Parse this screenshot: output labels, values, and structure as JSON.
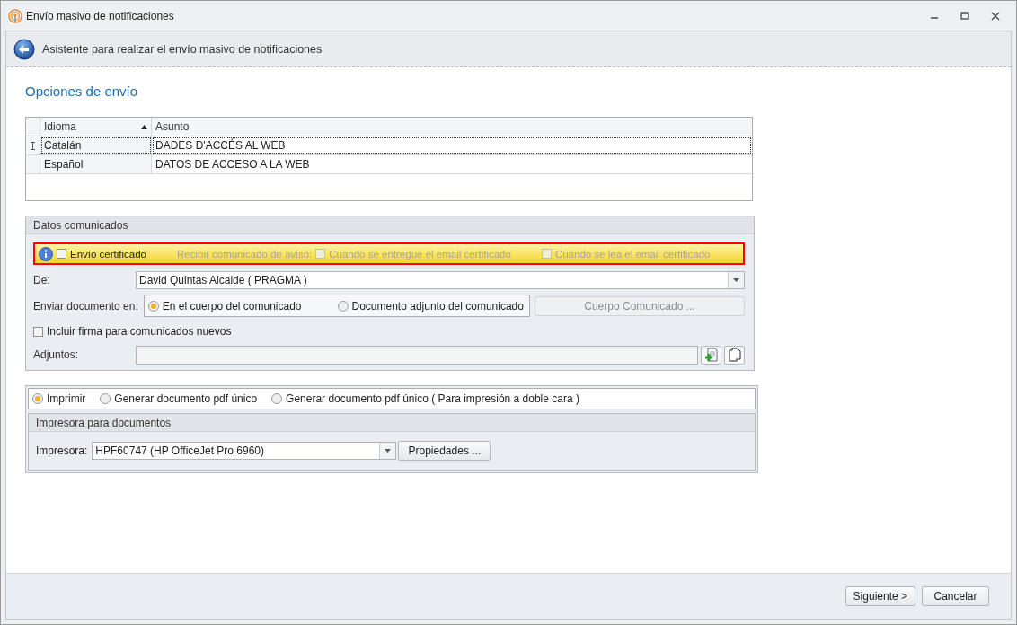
{
  "window": {
    "title": "Envío masivo de notificaciones"
  },
  "header": {
    "title": "Asistente para realizar el envío masivo de notificaciones"
  },
  "section_title": "Opciones de envío",
  "table": {
    "columns": [
      {
        "label": "Idioma",
        "sorted": true
      },
      {
        "label": "Asunto",
        "sorted": false
      }
    ],
    "rows": [
      {
        "cells": [
          "Catalán",
          "DADES D'ACCÉS AL WEB"
        ],
        "focused": true
      },
      {
        "cells": [
          "Español",
          "DATOS DE ACCESO A LA WEB"
        ],
        "focused": false
      }
    ]
  },
  "datos": {
    "title": "Datos comunicados",
    "certified": {
      "label": "Envío certificado",
      "checked": false
    },
    "notify_label": "Recibir comunicado de aviso:",
    "notify_options": [
      {
        "label": "Cuando se entregue el email certificado",
        "checked": false,
        "disabled": true
      },
      {
        "label": "Cuando se lea el email certificado",
        "checked": false,
        "disabled": true
      }
    ],
    "from": {
      "label": "De:",
      "value": "David Quintas Alcalde ( PRAGMA )"
    },
    "send_in": {
      "label": "Enviar documento en:",
      "options": [
        {
          "label": "En el cuerpo del comunicado",
          "selected": true
        },
        {
          "label": "Documento adjunto del comunicado",
          "selected": false
        }
      ],
      "body_button": {
        "label": "Cuerpo Comunicado ...",
        "disabled": true
      }
    },
    "signature": {
      "label": "Incluir firma para comunicados nuevos",
      "checked": false
    },
    "attachments": {
      "label": "Adjuntos:"
    }
  },
  "output": {
    "options": [
      {
        "label": "Imprimir",
        "selected": true
      },
      {
        "label": "Generar documento pdf único",
        "selected": false
      },
      {
        "label": "Generar documento pdf único ( Para impresión a doble cara )",
        "selected": false
      }
    ],
    "printer_group": {
      "title": "Impresora para documentos",
      "label": "Impresora:",
      "value": "HPF60747 (HP OfficeJet Pro 6960)",
      "button": "Propiedades ..."
    }
  },
  "buttons": [
    {
      "label": "Siguiente >"
    },
    {
      "label": "Cancelar"
    }
  ]
}
